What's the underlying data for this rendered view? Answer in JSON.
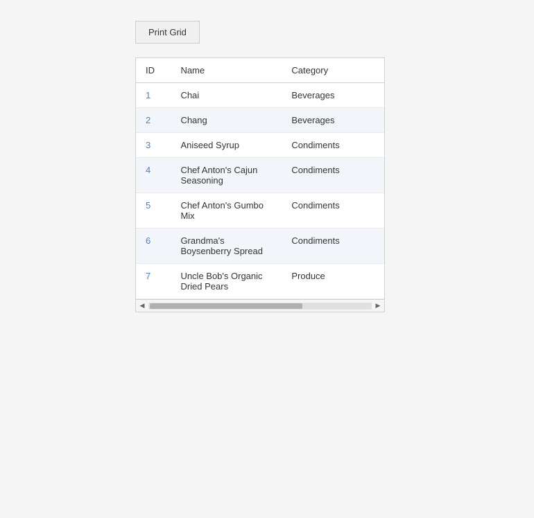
{
  "toolbar": {
    "print_btn_label": "Print Grid"
  },
  "table": {
    "columns": [
      {
        "key": "id",
        "label": "ID"
      },
      {
        "key": "name",
        "label": "Name"
      },
      {
        "key": "category",
        "label": "Category"
      }
    ],
    "rows": [
      {
        "id": "1",
        "name": "Chai",
        "category": "Beverages"
      },
      {
        "id": "2",
        "name": "Chang",
        "category": "Beverages"
      },
      {
        "id": "3",
        "name": "Aniseed Syrup",
        "category": "Condiments"
      },
      {
        "id": "4",
        "name": "Chef Anton's Cajun Seasoning",
        "category": "Condiments"
      },
      {
        "id": "5",
        "name": "Chef Anton's Gumbo Mix",
        "category": "Condiments"
      },
      {
        "id": "6",
        "name": "Grandma's Boysenberry Spread",
        "category": "Condiments"
      },
      {
        "id": "7",
        "name": "Uncle Bob's Organic Dried Pears",
        "category": "Produce"
      }
    ]
  }
}
